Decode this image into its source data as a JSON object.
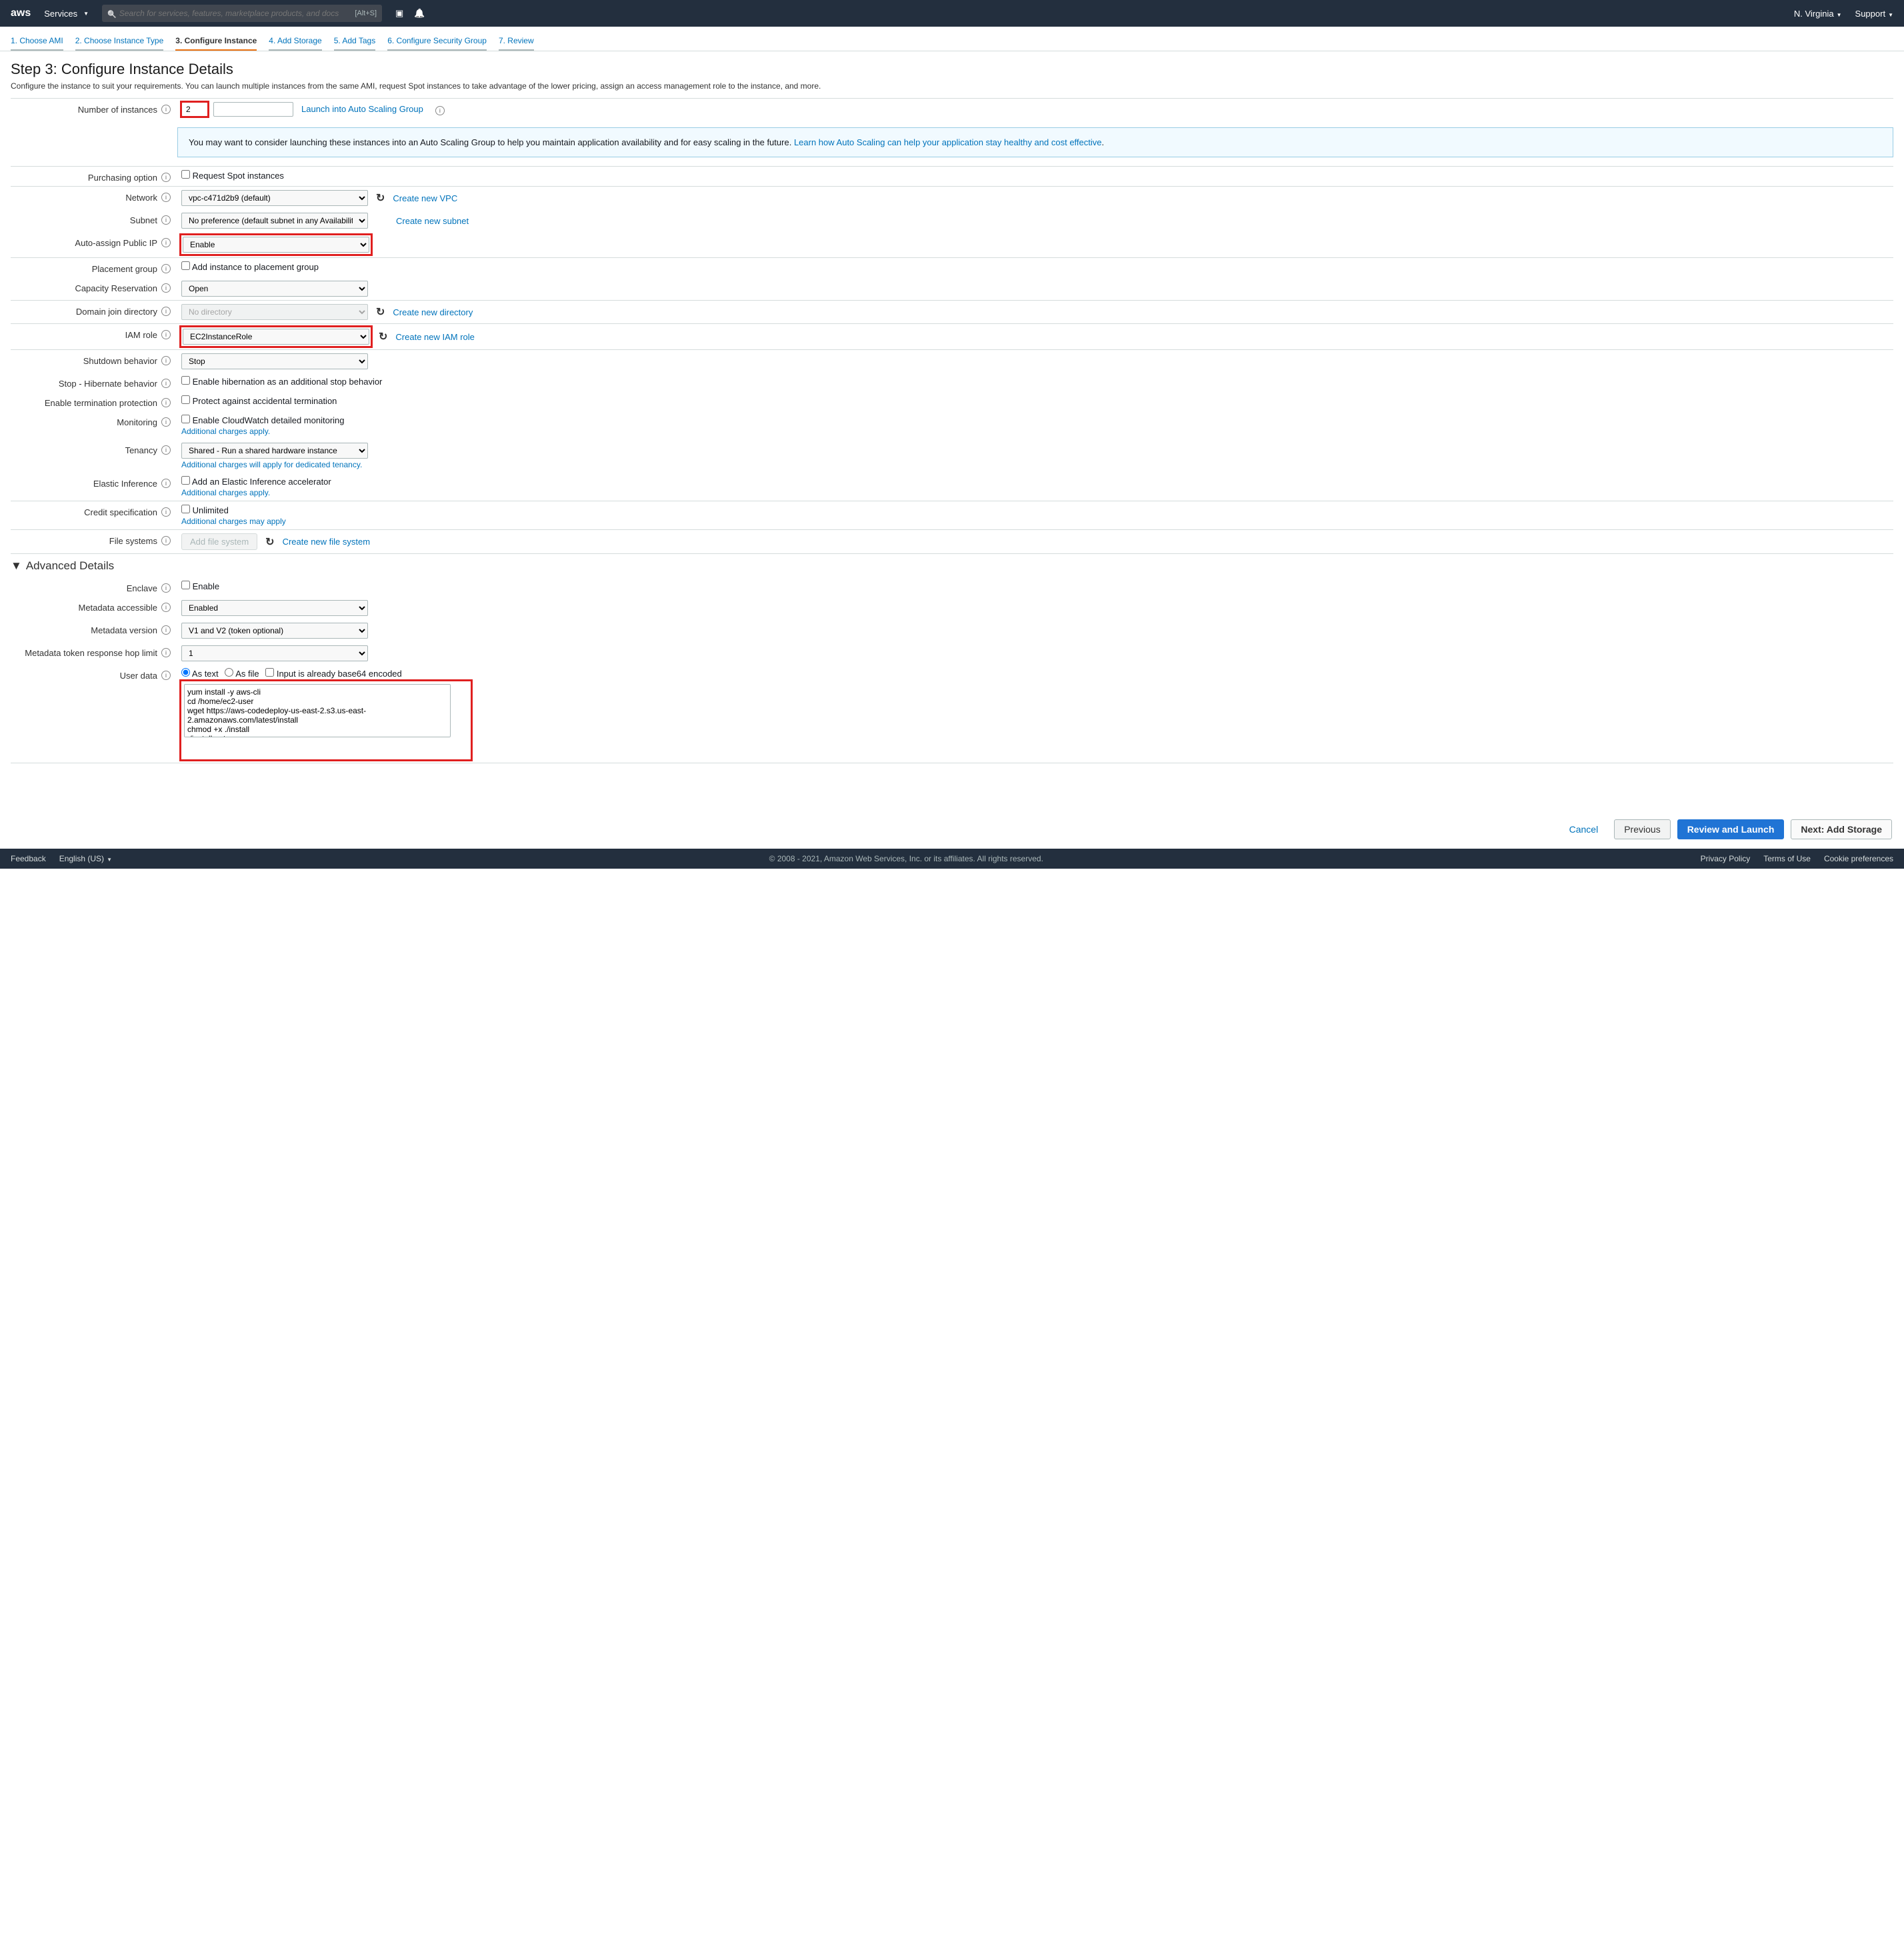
{
  "header": {
    "logo": "aws",
    "services": "Services",
    "search_placeholder": "Search for services, features, marketplace products, and docs",
    "search_shortcut": "[Alt+S]",
    "region": "N. Virginia",
    "support": "Support"
  },
  "wizard": {
    "tabs": [
      "1. Choose AMI",
      "2. Choose Instance Type",
      "3. Configure Instance",
      "4. Add Storage",
      "5. Add Tags",
      "6. Configure Security Group",
      "7. Review"
    ],
    "active_index": 2
  },
  "page": {
    "title": "Step 3: Configure Instance Details",
    "description": "Configure the instance to suit your requirements. You can launch multiple instances from the same AMI, request Spot instances to take advantage of the lower pricing, assign an access management role to the instance, and more."
  },
  "fields": {
    "number_of_instances": {
      "label": "Number of instances",
      "value": "2",
      "link": "Launch into Auto Scaling Group"
    },
    "asg_alert": {
      "text": "You may want to consider launching these instances into an Auto Scaling Group to help you maintain application availability and for easy scaling in the future.",
      "link": "Learn how Auto Scaling can help your application stay healthy and cost effective"
    },
    "purchasing_option": {
      "label": "Purchasing option",
      "checkbox": "Request Spot instances"
    },
    "network": {
      "label": "Network",
      "value": "vpc-c471d2b9 (default)",
      "link": "Create new VPC"
    },
    "subnet": {
      "label": "Subnet",
      "value": "No preference (default subnet in any Availability Zone)",
      "link": "Create new subnet"
    },
    "auto_assign_ip": {
      "label": "Auto-assign Public IP",
      "value": "Enable"
    },
    "placement_group": {
      "label": "Placement group",
      "checkbox": "Add instance to placement group"
    },
    "capacity_reservation": {
      "label": "Capacity Reservation",
      "value": "Open"
    },
    "domain_join": {
      "label": "Domain join directory",
      "value": "No directory",
      "link": "Create new directory"
    },
    "iam_role": {
      "label": "IAM role",
      "value": "EC2InstanceRole",
      "link": "Create new IAM role"
    },
    "shutdown_behavior": {
      "label": "Shutdown behavior",
      "value": "Stop"
    },
    "hibernate": {
      "label": "Stop - Hibernate behavior",
      "checkbox": "Enable hibernation as an additional stop behavior"
    },
    "termination_protection": {
      "label": "Enable termination protection",
      "checkbox": "Protect against accidental termination"
    },
    "monitoring": {
      "label": "Monitoring",
      "checkbox": "Enable CloudWatch detailed monitoring",
      "note": "Additional charges apply."
    },
    "tenancy": {
      "label": "Tenancy",
      "value": "Shared - Run a shared hardware instance",
      "note": "Additional charges will apply for dedicated tenancy."
    },
    "elastic_inference": {
      "label": "Elastic Inference",
      "checkbox": "Add an Elastic Inference accelerator",
      "note": "Additional charges apply."
    },
    "credit_spec": {
      "label": "Credit specification",
      "checkbox": "Unlimited",
      "note": "Additional charges may apply"
    },
    "file_systems": {
      "label": "File systems",
      "button": "Add file system",
      "link": "Create new file system"
    },
    "advanced_header": "Advanced Details",
    "enclave": {
      "label": "Enclave",
      "checkbox": "Enable"
    },
    "metadata_accessible": {
      "label": "Metadata accessible",
      "value": "Enabled"
    },
    "metadata_version": {
      "label": "Metadata version",
      "value": "V1 and V2 (token optional)"
    },
    "metadata_hop": {
      "label": "Metadata token response hop limit",
      "value": "1"
    },
    "user_data": {
      "label": "User data",
      "opt_text": "As text",
      "opt_file": "As file",
      "opt_base64": "Input is already base64 encoded",
      "value": "yum install -y aws-cli\ncd /home/ec2-user\nwget https://aws-codedeploy-us-east-2.s3.us-east-2.amazonaws.com/latest/install\nchmod +x ./install\n./install auto"
    }
  },
  "actions": {
    "cancel": "Cancel",
    "previous": "Previous",
    "review": "Review and Launch",
    "next": "Next: Add Storage"
  },
  "footer": {
    "feedback": "Feedback",
    "language": "English (US)",
    "copyright": "© 2008 - 2021, Amazon Web Services, Inc. or its affiliates. All rights reserved.",
    "privacy": "Privacy Policy",
    "terms": "Terms of Use",
    "cookies": "Cookie preferences"
  }
}
